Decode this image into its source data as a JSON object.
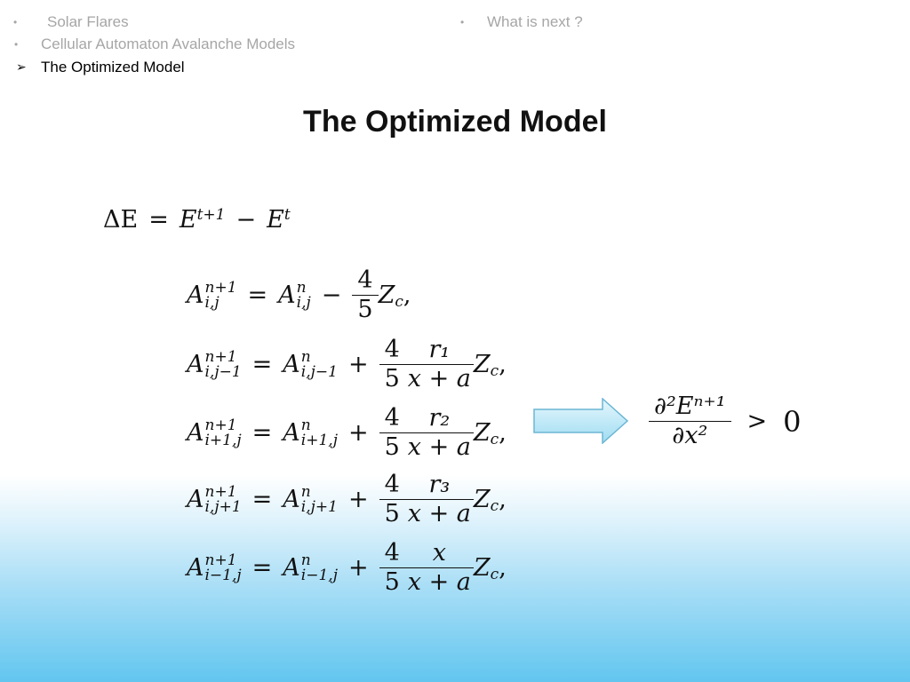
{
  "nav": {
    "items": [
      {
        "label": "Solar Flares",
        "bullet": "•"
      },
      {
        "label": "Cellular Automaton Avalanche Models",
        "bullet": "•"
      },
      {
        "label": "The Optimized Model",
        "bullet": "➢"
      },
      {
        "label": "What is next ?",
        "bullet": "•"
      }
    ]
  },
  "slide": {
    "title": "The Optimized Model"
  },
  "equations": {
    "delta": {
      "lhs": "ΔE",
      "eq": "=",
      "e1": "E",
      "e1sup": "t+1",
      "minus": "−",
      "e2": "E",
      "e2sup": "t"
    },
    "rows": [
      {
        "A": "A",
        "lsup": "n+1",
        "lsub": "i,j",
        "eq": "=",
        "rsup": "n",
        "rsub": "i,j",
        "op": "−",
        "fn": "4",
        "fd": "5",
        "gn": "",
        "gd": "",
        "Z": "Z",
        "zsub": "c",
        "end": ","
      },
      {
        "A": "A",
        "lsup": "n+1",
        "lsub": "i,j−1",
        "eq": "=",
        "rsup": "n",
        "rsub": "i,j−1",
        "op": "+",
        "fn": "4",
        "fd": "5",
        "gn": "r₁",
        "gd": "x + a",
        "Z": "Z",
        "zsub": "c",
        "end": ","
      },
      {
        "A": "A",
        "lsup": "n+1",
        "lsub": "i+1,j",
        "eq": "=",
        "rsup": "n",
        "rsub": "i+1,j",
        "op": "+",
        "fn": "4",
        "fd": "5",
        "gn": "r₂",
        "gd": "x + a",
        "Z": "Z",
        "zsub": "c",
        "end": ","
      },
      {
        "A": "A",
        "lsup": "n+1",
        "lsub": "i,j+1",
        "eq": "=",
        "rsup": "n",
        "rsub": "i,j+1",
        "op": "+",
        "fn": "4",
        "fd": "5",
        "gn": "r₃",
        "gd": "x + a",
        "Z": "Z",
        "zsub": "c",
        "end": ","
      },
      {
        "A": "A",
        "lsup": "n+1",
        "lsub": "i−1,j",
        "eq": "=",
        "rsup": "n",
        "rsub": "i−1,j",
        "op": "+",
        "fn": "4",
        "fd": "5",
        "gn": "x",
        "gd": "x + a",
        "Z": "Z",
        "zsub": "c",
        "end": ","
      }
    ],
    "condition": {
      "num": "∂²Eⁿ⁺¹",
      "den": "∂x²",
      "rel": ">",
      "rhs": "0"
    }
  },
  "colors": {
    "arrow_fill": "#bfe9f7",
    "arrow_stroke": "#6cb6d3",
    "bottom_gradient": "#62c6ef"
  },
  "icons": {
    "arrow": "right-arrow-icon"
  }
}
